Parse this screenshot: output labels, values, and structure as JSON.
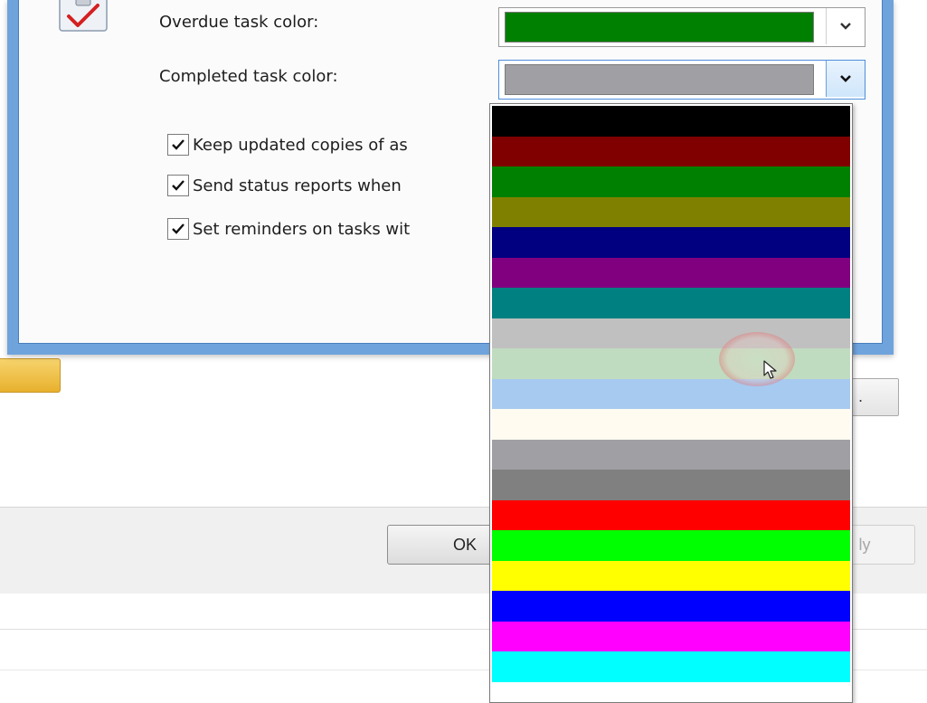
{
  "dialog": {
    "overdue_label": "Overdue task color:",
    "completed_label": "Completed task color:",
    "overdue_color": "#008000",
    "completed_color": "#a0a0a4",
    "checkboxes": [
      {
        "label": "Keep updated copies of as",
        "checked": true
      },
      {
        "label": "Send status reports when",
        "checked": true
      },
      {
        "label": "Set reminders on tasks wit",
        "checked": true
      }
    ]
  },
  "dropdown": {
    "colors": [
      "#000000",
      "#800000",
      "#008000",
      "#808000",
      "#000080",
      "#800080",
      "#008080",
      "#c0c0c0",
      "#c0dcc0",
      "#a6caf0",
      "#fffbf0",
      "#a0a0a4",
      "#808080",
      "#ff0000",
      "#00ff00",
      "#ffff00",
      "#0000ff",
      "#ff00ff",
      "#00ffff",
      "#ffffff"
    ],
    "hovered_index": 8
  },
  "footer": {
    "ok_label": "OK",
    "apply_label": "ly"
  },
  "side_button": {
    "label": "."
  },
  "icons": {
    "tasks": "clipboard-checkmark-icon",
    "dropdown_arrow": "chevron-down-icon",
    "pointer": "mouse-pointer-icon"
  }
}
